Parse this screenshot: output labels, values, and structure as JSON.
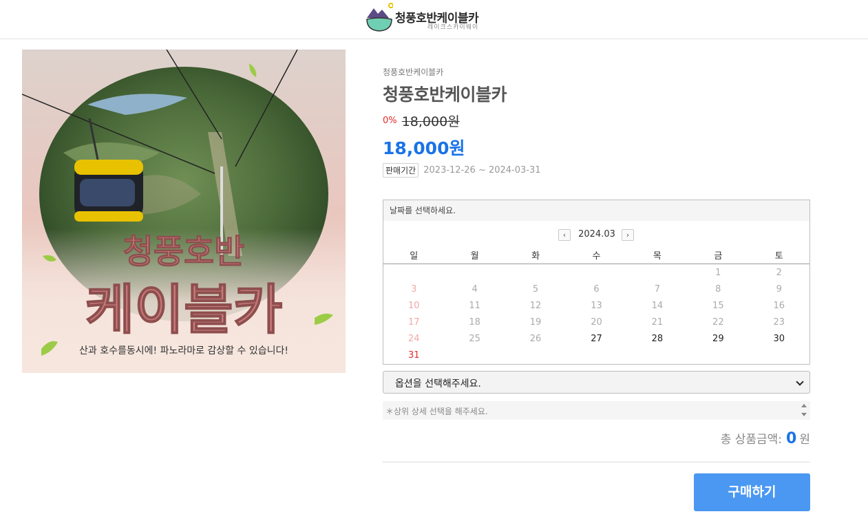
{
  "header": {
    "logo_title": "청풍호반케이블카",
    "logo_subtitle": "레이크스카이웨이"
  },
  "product_image": {
    "title_line1": "청풍호반",
    "title_line2": "케이블카",
    "caption": "산과 호수를동시에! 파노라마로 감상할 수 있습니다!"
  },
  "product": {
    "breadcrumb": "청풍호반케이블카",
    "title": "청풍호반케이블카",
    "discount_rate": "0%",
    "original_price": "18,000원",
    "sale_price": "18,000원",
    "period_label": "판매기간",
    "period_range": "2023-12-26 ~ 2024-03-31"
  },
  "calendar": {
    "prompt": "날짜를 선택하세요.",
    "month": "2024.03",
    "prev_icon": "chevron-left-icon",
    "next_icon": "chevron-right-icon",
    "weekdays": [
      "일",
      "월",
      "화",
      "수",
      "목",
      "금",
      "토"
    ],
    "weeks": [
      [
        "",
        "",
        "",
        "",
        "",
        "1",
        "2"
      ],
      [
        "3",
        "4",
        "5",
        "6",
        "7",
        "8",
        "9"
      ],
      [
        "10",
        "11",
        "12",
        "13",
        "14",
        "15",
        "16"
      ],
      [
        "17",
        "18",
        "19",
        "20",
        "21",
        "22",
        "23"
      ],
      [
        "24",
        "25",
        "26",
        "27",
        "28",
        "29",
        "30"
      ],
      [
        "31",
        "",
        "",
        "",
        "",
        "",
        ""
      ]
    ],
    "available_days": [
      "27",
      "28",
      "29",
      "30",
      "31"
    ]
  },
  "options": {
    "select_placeholder": "옵션을 선택해주세요.",
    "notice": "＊상위 상세 선택을 해주세요."
  },
  "total": {
    "label": "총 상품금액:",
    "amount": "0",
    "unit": "원"
  },
  "buy_button": "구매하기",
  "colors": {
    "accent_blue": "#1a73e8",
    "buy_button": "#4a98f2",
    "discount_red": "#e52929"
  }
}
